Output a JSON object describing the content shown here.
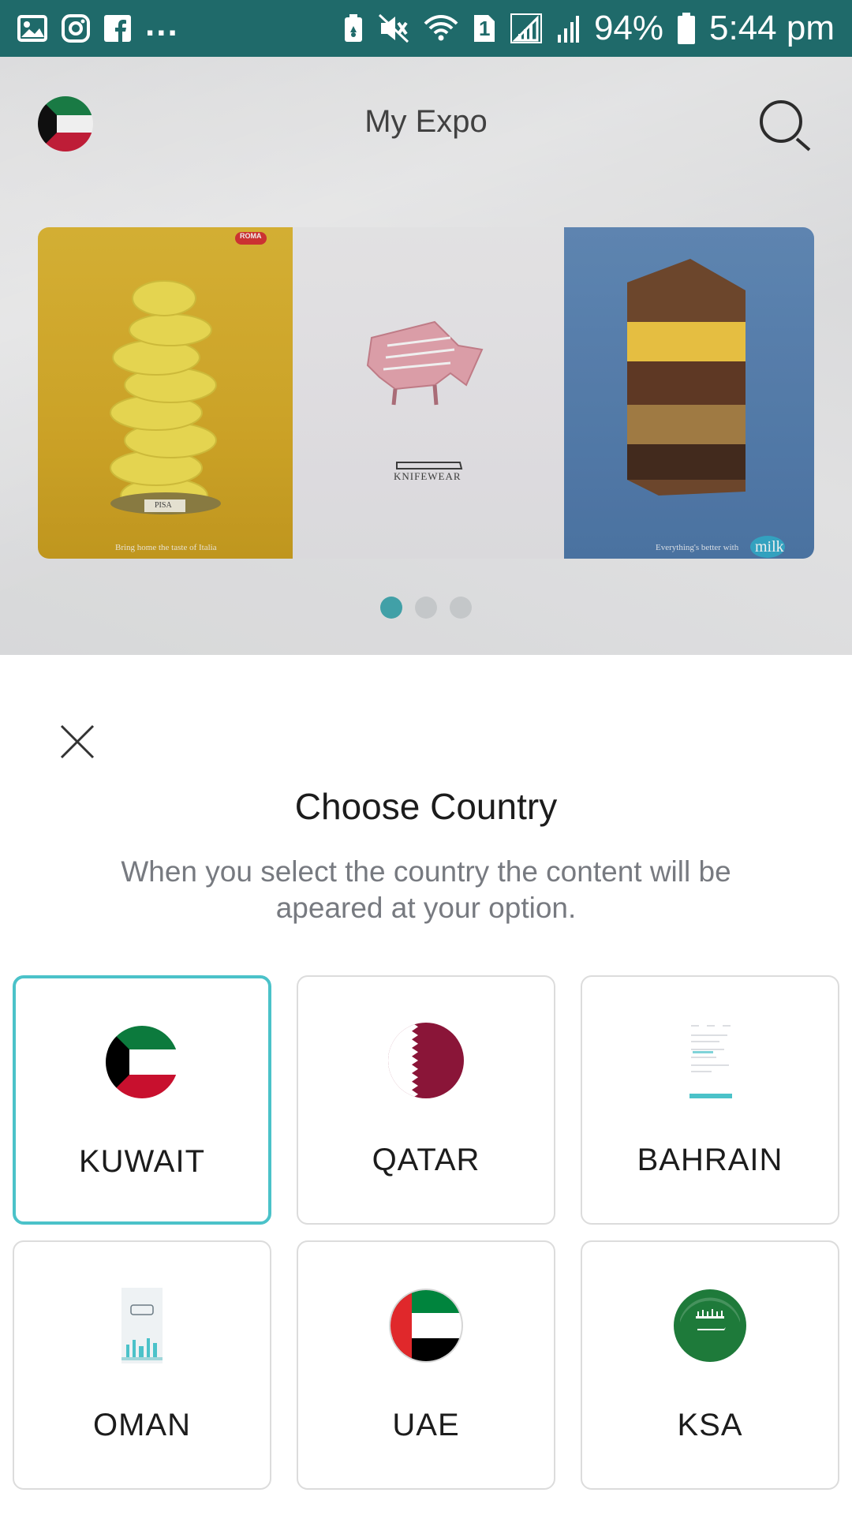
{
  "status_bar": {
    "overflow": "...",
    "battery": "94%",
    "time": "5:44 pm",
    "sim_badge": "1",
    "icons": [
      "gallery-icon",
      "instagram-icon",
      "facebook-icon",
      "battery-saver-icon",
      "mute-icon",
      "wifi-icon",
      "sim-icon",
      "signal-icon",
      "signal-icon",
      "battery-icon"
    ]
  },
  "app": {
    "title": "My Expo",
    "banner": {
      "slides": [
        {
          "brand": "ROMA",
          "label": "PISA",
          "caption": "Bring home the taste of Italia"
        },
        {
          "brand": "KNIFEWEAR",
          "caption": ""
        },
        {
          "brand": "milk",
          "caption": "Everything's better with"
        }
      ],
      "active_index": 0
    }
  },
  "sheet": {
    "title": "Choose Country",
    "description": "When you select the country the content will be apeared at your option.",
    "countries": [
      {
        "name": "KUWAIT",
        "flag": "kuwait-flag-icon",
        "selected": true
      },
      {
        "name": "QATAR",
        "flag": "qatar-flag-icon",
        "selected": false
      },
      {
        "name": "BAHRAIN",
        "flag": "bahrain-screenshot-thumbnail",
        "selected": false
      },
      {
        "name": "OMAN",
        "flag": "oman-screenshot-thumbnail",
        "selected": false
      },
      {
        "name": "UAE",
        "flag": "uae-flag-icon",
        "selected": false
      },
      {
        "name": "KSA",
        "flag": "ksa-flag-icon",
        "selected": false
      }
    ]
  },
  "colors": {
    "status_bar": "#1f6a6a",
    "accent": "#4bc2c9",
    "dot_active": "#3aa6ad"
  }
}
